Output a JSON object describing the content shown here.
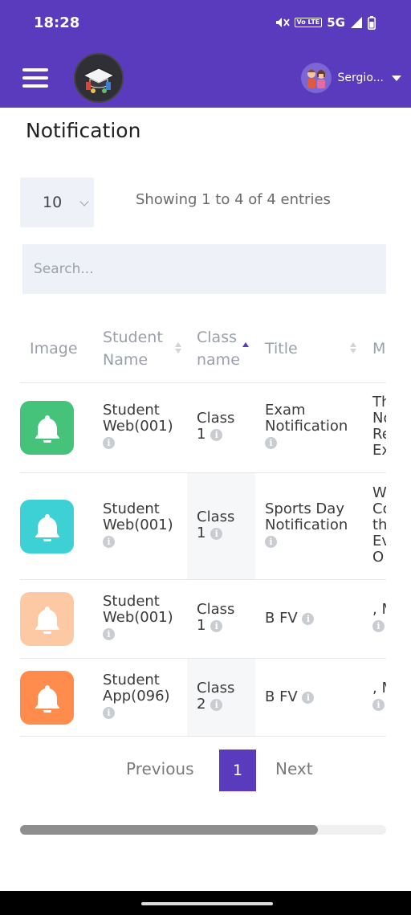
{
  "status_bar": {
    "time": "18:28",
    "volte": "Vo LTE",
    "network": "5G"
  },
  "header": {
    "username": "Sergio..."
  },
  "page": {
    "title": "Notification"
  },
  "controls": {
    "length_value": "10",
    "info": "Showing 1 to 4 of 4 entries",
    "search_placeholder": "Search..."
  },
  "table": {
    "columns": [
      "Image",
      "Student Name",
      "Class name",
      "Title",
      "M"
    ],
    "rows": [
      {
        "bell_color": "#46c37b",
        "student_line1": "Student",
        "student_line2": "Web(001)",
        "class_line1": "Class",
        "class_line2": "1",
        "title_line1": "Exam",
        "title_line2": "Notification",
        "message_lines": [
          "Th",
          "No",
          "Re",
          "Ex"
        ]
      },
      {
        "bell_color": "#3dd0d4",
        "student_line1": "Student",
        "student_line2": "Web(001)",
        "class_line1": "Class",
        "class_line2": "1",
        "title_line1": "Sports Day",
        "title_line2": "Notification",
        "message_lines": [
          "W",
          "Co",
          "th",
          "Ev",
          "O"
        ]
      },
      {
        "bell_color": "#fcc9a4",
        "student_line1": "Student",
        "student_line2": "Web(001)",
        "class_line1": "Class",
        "class_line2": "1",
        "title_line1": "B FV",
        "title_line2": "",
        "message_lines": [
          ", M"
        ]
      },
      {
        "bell_color": "#ff8c4d",
        "student_line1": "Student",
        "student_line2": "App(096)",
        "class_line1": "Class",
        "class_line2": "2",
        "title_line1": "B FV",
        "title_line2": "",
        "message_lines": [
          ", M"
        ]
      }
    ]
  },
  "pagination": {
    "previous": "Previous",
    "current": "1",
    "next": "Next"
  },
  "colors": {
    "brand": "#5b3bbd",
    "active_sort": "#5b3bbd"
  }
}
